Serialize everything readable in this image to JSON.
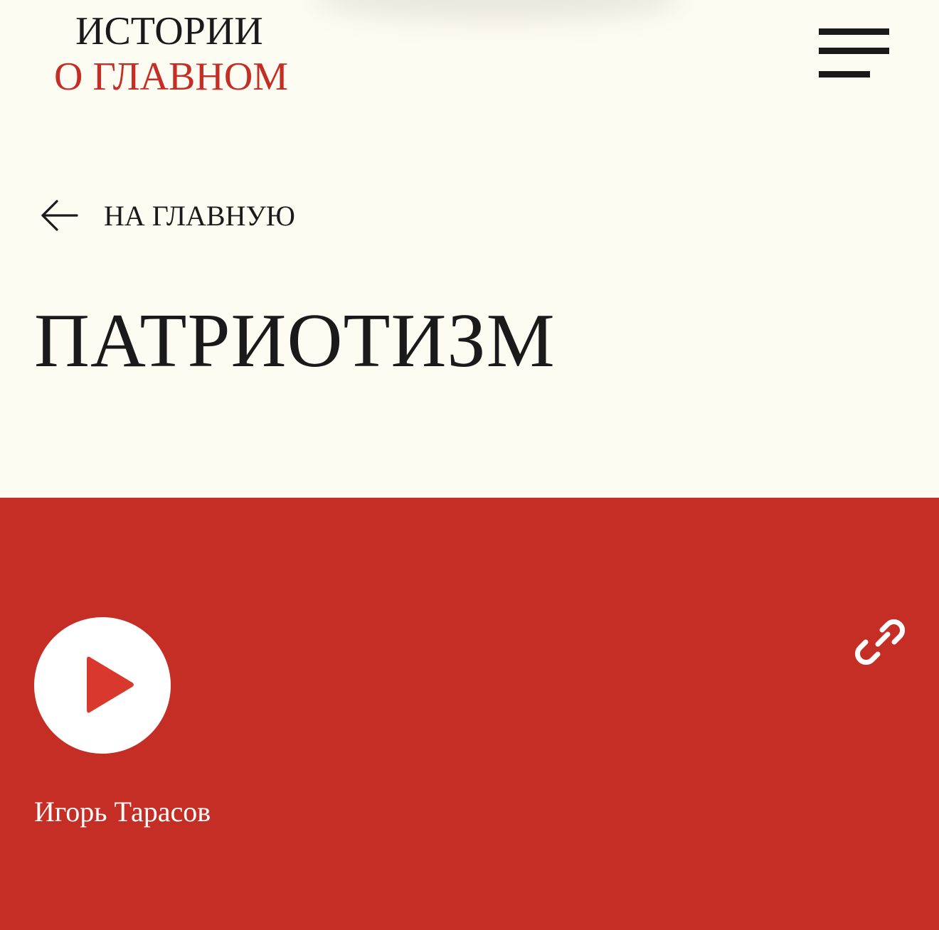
{
  "header": {
    "logo": {
      "line1": "ИСТОРИИ",
      "line2": "О ГЛАВНОМ"
    },
    "menu_icon": "hamburger-menu-icon"
  },
  "nav": {
    "back_label": "НА ГЛАВНУЮ",
    "back_icon": "arrow-left-icon"
  },
  "page": {
    "title": "ПАТРИОТИЗМ"
  },
  "player": {
    "author": "Игорь Тарасов",
    "play_icon": "play-icon",
    "link_icon": "link-icon"
  },
  "colors": {
    "background": "#fdfcf2",
    "accent_red": "#c42e24",
    "text_dark": "#1a1a1a",
    "play_triangle": "#d9392c"
  }
}
